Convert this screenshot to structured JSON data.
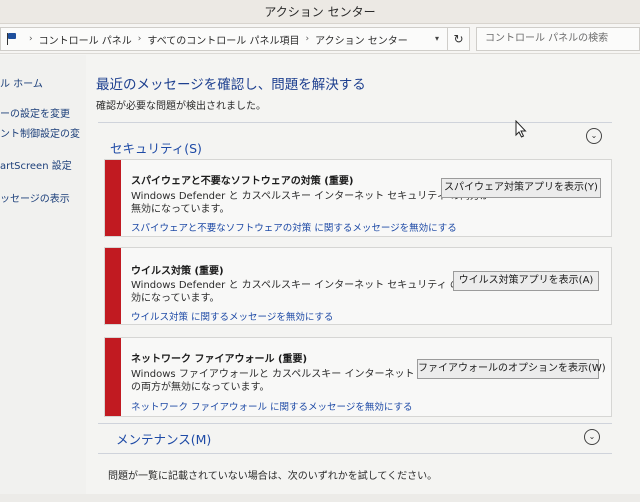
{
  "window": {
    "title": "アクション センター"
  },
  "address": {
    "breadcrumbs": [
      "コントロール パネル",
      "すべてのコントロール パネル項目",
      "アクション センター"
    ],
    "dropdown_glyph": "▾",
    "refresh_glyph": "↻",
    "search_placeholder": "コントロール パネルの検索",
    "separator": "›"
  },
  "sidebar": {
    "items": [
      {
        "label": "ル ホーム"
      },
      {
        "label": "ーの設定を変更"
      },
      {
        "label": "ント制御設定の変"
      },
      {
        "label": "artScreen 設定"
      },
      {
        "label": "ッセージの表示"
      }
    ]
  },
  "main": {
    "title": "最近のメッセージを確認し、問題を解決する",
    "subtitle": "確認が必要な問題が検出されました。",
    "security": {
      "title": "セキュリティ(S)",
      "alerts": [
        {
          "title": "スパイウェアと不要なソフトウェアの対策 (重要)",
          "line1": "Windows Defender と カスペルスキー インターネット セキュリティ の両方が",
          "line2": "無効になっています。",
          "link": "スパイウェアと不要なソフトウェアの対策 に関するメッセージを無効にする",
          "button": "スパイウェア対策アプリを表示(Y)"
        },
        {
          "title": "ウイルス対策 (重要)",
          "line1": "Windows Defender と カスペルスキー インターネット セキュリティ の両方が無",
          "line2": "効になっています。",
          "link": "ウイルス対策 に関するメッセージを無効にする",
          "button": "ウイルス対策アプリを表示(A)"
        },
        {
          "title": "ネットワーク ファイアウォール (重要)",
          "line1": "Windows ファイアウォールと カスペルスキー インターネット セキュリティ",
          "line2": "の両方が無効になっています。",
          "link": "ネットワーク ファイアウォール に関するメッセージを無効にする",
          "button": "ファイアウォールのオプションを表示(W)"
        }
      ]
    },
    "maintenance": {
      "title": "メンテナンス(M)"
    },
    "footer": "問題が一覧に記載されていない場合は、次のいずれかを試してください。",
    "chevron_glyph": "⌄"
  },
  "colors": {
    "accent": "#1e4aa6",
    "alert_red": "#c11a21"
  }
}
